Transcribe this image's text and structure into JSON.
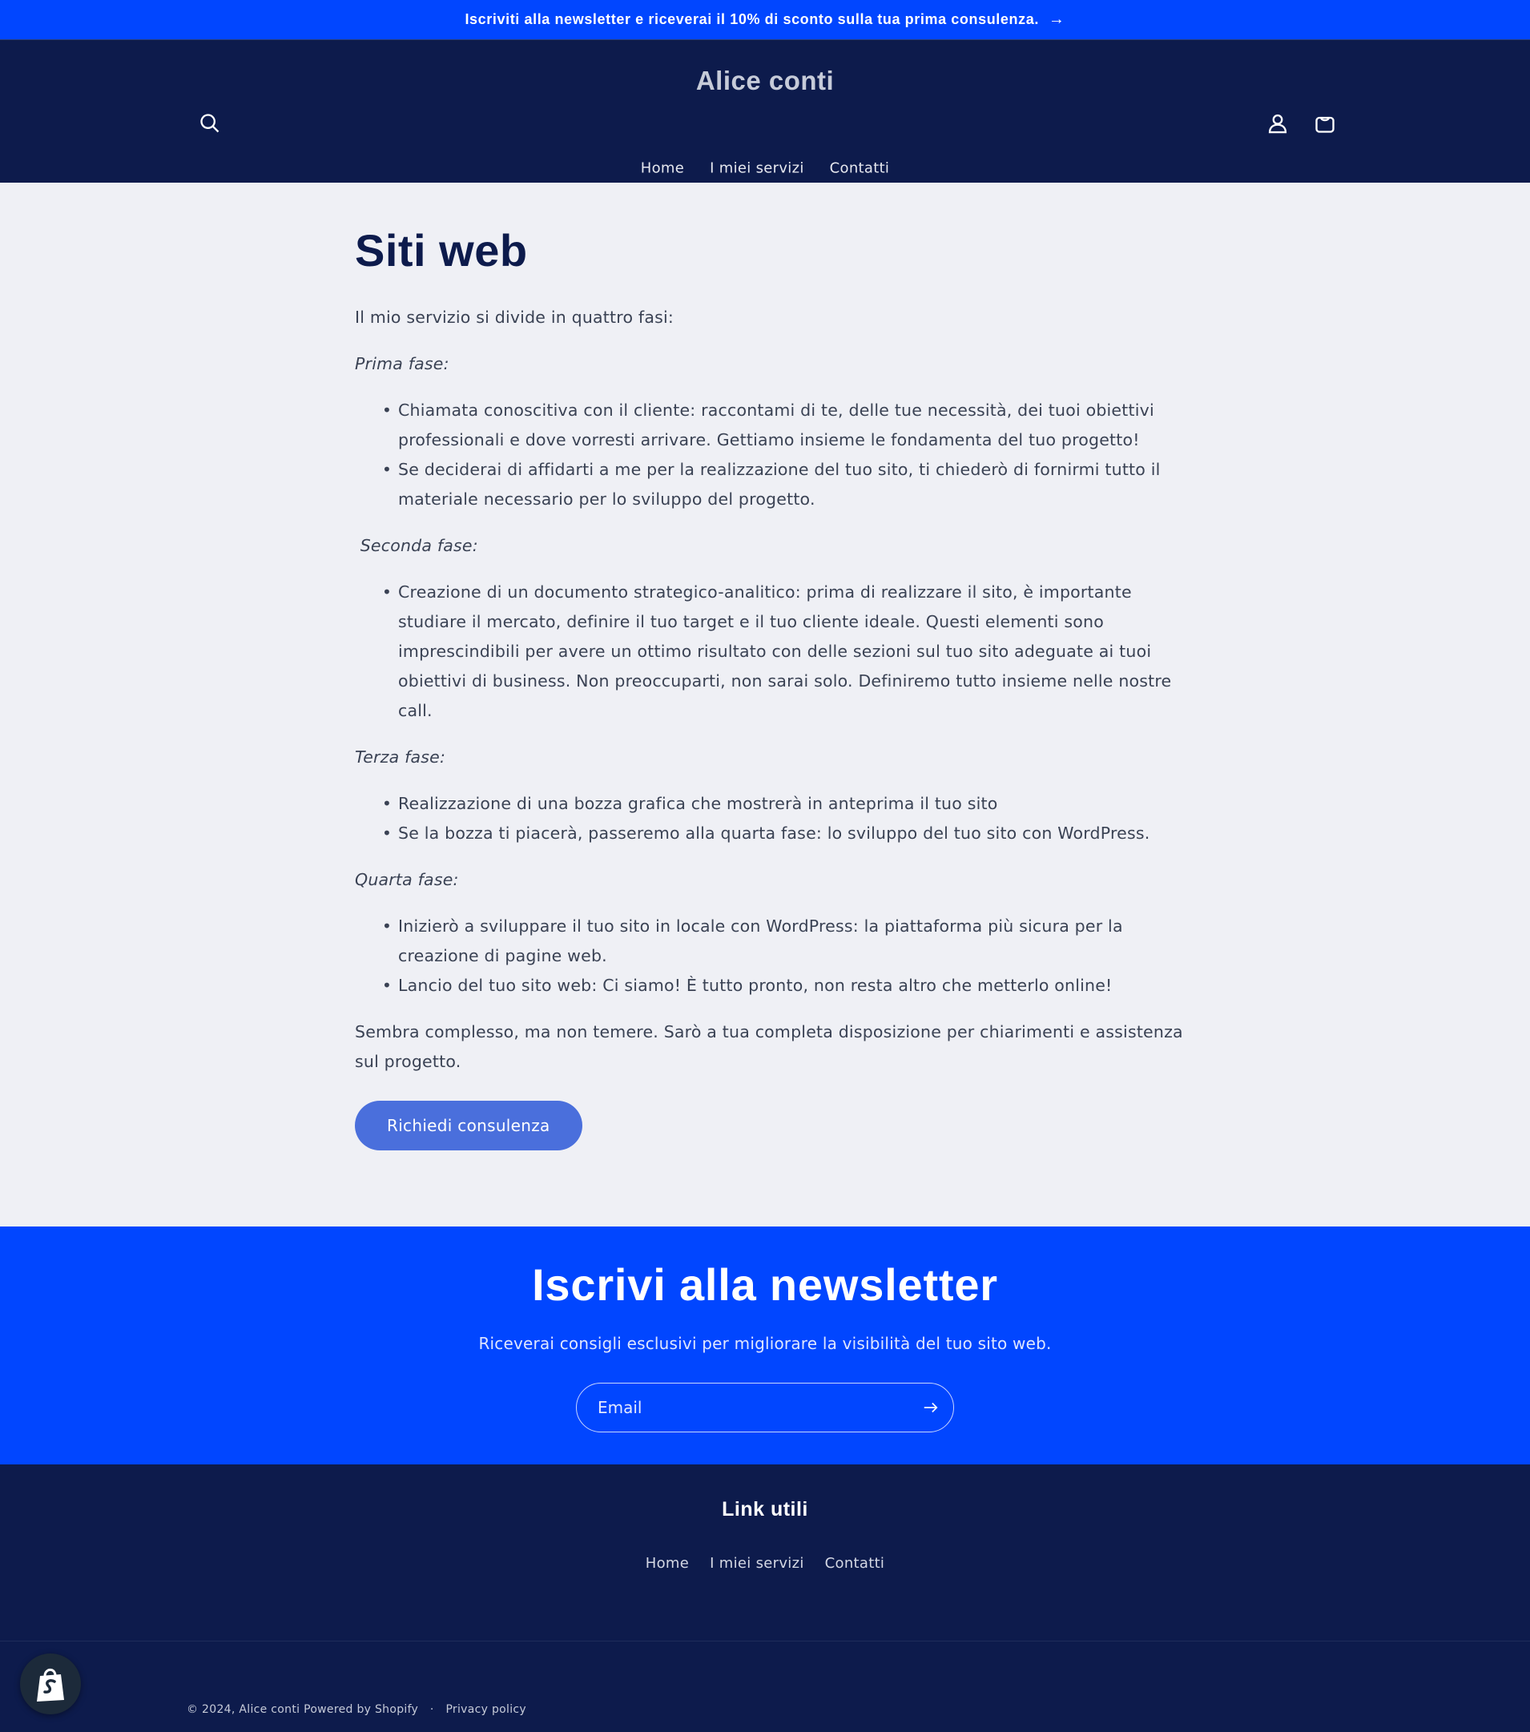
{
  "announcement": {
    "text": "Iscriviti alla newsletter e riceverai il 10% di sconto sulla tua prima consulenza.",
    "arrow": "→"
  },
  "header": {
    "logo": "Alice conti",
    "nav": [
      "Home",
      "I miei servizi",
      "Contatti"
    ],
    "icons": [
      "search-icon",
      "account-icon",
      "cart-icon"
    ]
  },
  "page": {
    "title": "Siti web",
    "intro": "Il mio servizio si divide in quattro fasi:",
    "phases": [
      {
        "label": "Prima fase:",
        "items": [
          "Chiamata conoscitiva con il cliente: raccontami di te, delle tue necessità, dei tuoi obiettivi professionali e dove vorresti arrivare. Gettiamo insieme le fondamenta del tuo progetto!",
          "Se deciderai di affidarti a me per la realizzazione del tuo sito, ti chiederò di fornirmi tutto il materiale necessario per lo sviluppo del progetto."
        ]
      },
      {
        "label": " Seconda fase:",
        "items": [
          "Creazione di un documento strategico-analitico: prima di realizzare il sito, è importante studiare il mercato, definire il tuo target e il tuo cliente ideale. Questi elementi sono imprescindibili per avere un ottimo risultato con delle sezioni sul tuo sito adeguate ai tuoi obiettivi di business. Non preoccuparti, non sarai solo. Definiremo tutto insieme nelle nostre call."
        ]
      },
      {
        "label": "Terza fase:",
        "items": [
          "Realizzazione di una bozza grafica che mostrerà in anteprima il tuo sito",
          "Se la bozza ti piacerà, passeremo alla quarta fase: lo sviluppo del tuo sito con WordPress."
        ]
      },
      {
        "label": "Quarta fase:",
        "items": [
          "Inizierò a sviluppare il tuo sito in locale con WordPress: la piattaforma più sicura per la creazione di pagine web.",
          "Lancio del tuo sito web: Ci siamo! È tutto pronto, non resta altro che metterlo online!"
        ]
      }
    ],
    "closing": " Sembra complesso, ma non temere. Sarò a tua completa disposizione per chiarimenti e assistenza sul progetto.",
    "cta": "Richiedi consulenza"
  },
  "newsletter": {
    "title": "Iscrivi alla newsletter",
    "subtitle": "Riceverai consigli esclusivi per migliorare la visibilità del tuo sito web.",
    "email_placeholder": "Email"
  },
  "footer": {
    "heading": "Link utili",
    "links": [
      "Home",
      "I miei servizi",
      "Contatti"
    ],
    "copyright": "© 2024, Alice conti",
    "powered": "Powered by Shopify",
    "separator": "·",
    "privacy": "Privacy policy"
  },
  "colors": {
    "announcement_bg": "#0146ff",
    "header_bg": "#0d1b4c",
    "page_bg": "#eff0f5",
    "button_bg": "#4a6fdc"
  }
}
